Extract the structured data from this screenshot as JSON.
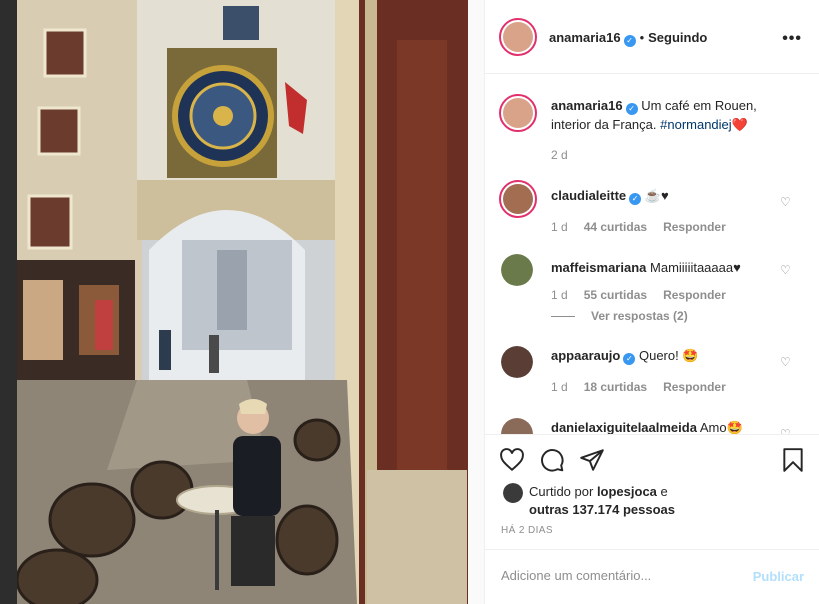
{
  "post": {
    "author": "anamaria16",
    "follow_status": "Seguindo",
    "more_label": "•••"
  },
  "caption": {
    "author": "anamaria16",
    "text": "Um café em Rouen, interior da França.",
    "hashtag": "#normandiej",
    "emoji": "❤️",
    "age": "2 d"
  },
  "comments": [
    {
      "user": "claudialeitte",
      "verified": true,
      "text": "☕♥",
      "age": "1 d",
      "likes": "44 curtidas",
      "reply_label": "Responder"
    },
    {
      "user": "maffeismariana",
      "verified": false,
      "text": "Mamiiiiitaaaaa♥",
      "age": "1 d",
      "likes": "55 curtidas",
      "reply_label": "Responder",
      "view_replies": "Ver respostas (2)"
    },
    {
      "user": "appaaraujo",
      "verified": true,
      "text": "Quero! 🤩",
      "age": "1 d",
      "likes": "18 curtidas",
      "reply_label": "Responder"
    },
    {
      "user": "danielaxiguitelaalmeida",
      "verified": false,
      "text": "Amo🤩"
    }
  ],
  "likes": {
    "prefix": "Curtido por",
    "user": "lopesjoca",
    "connector": "e",
    "others": "outras 137.174 pessoas"
  },
  "timestamp": "HÁ 2 DIAS",
  "comment_box": {
    "placeholder": "Adicione um comentário...",
    "publish_label": "Publicar"
  },
  "colors": {
    "verified": "#3897f0",
    "like_heart": "#ed4956",
    "publish_disabled": "#b2dffc",
    "story_ring": "#e1306c"
  }
}
